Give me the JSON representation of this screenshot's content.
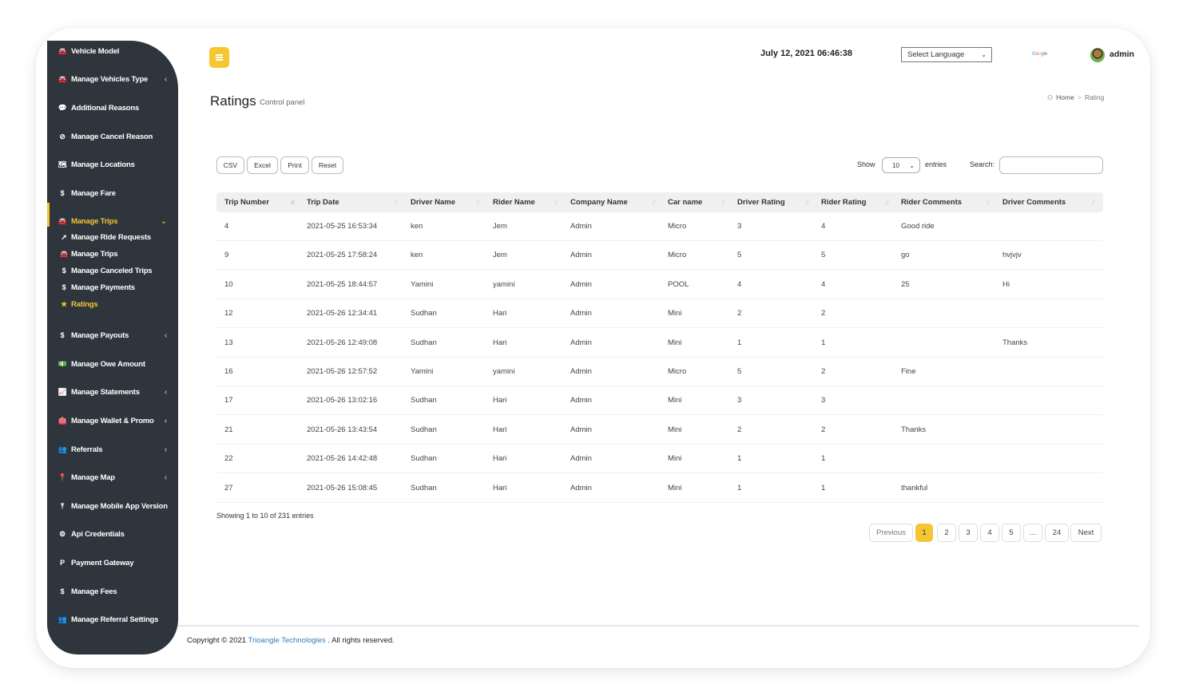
{
  "sidebar": {
    "items": [
      {
        "icon": "car-icon",
        "glyph": "🚘",
        "label": "Vehicle Model",
        "chevron": false
      },
      {
        "icon": "car-icon",
        "glyph": "🚘",
        "label": "Manage Vehicles Type",
        "chevron": true
      },
      {
        "icon": "comment-icon",
        "glyph": "💬",
        "label": "Additional Reasons",
        "chevron": false
      },
      {
        "icon": "ban-icon",
        "glyph": "⊘",
        "label": "Manage Cancel Reason",
        "chevron": false
      },
      {
        "icon": "map-icon",
        "glyph": "🗺",
        "label": "Manage Locations",
        "chevron": false
      },
      {
        "icon": "dollar-icon",
        "glyph": "$",
        "label": "Manage Fare",
        "chevron": false
      },
      {
        "icon": "car-icon",
        "glyph": "🚘",
        "label": "Manage Trips",
        "chevron": true,
        "active": true,
        "expanded": true
      },
      {
        "icon": "dollar-icon",
        "glyph": "$",
        "label": "Manage Payouts",
        "chevron": true
      },
      {
        "icon": "money-icon",
        "glyph": "💵",
        "label": "Manage Owe Amount",
        "chevron": false
      },
      {
        "icon": "chart-area-icon",
        "glyph": "📈",
        "label": "Manage Statements",
        "chevron": true
      },
      {
        "icon": "wallet-icon",
        "glyph": "👛",
        "label": "Manage Wallet & Promo",
        "chevron": true
      },
      {
        "icon": "users-icon",
        "glyph": "👥",
        "label": "Referrals",
        "chevron": true
      },
      {
        "icon": "map-marker-icon",
        "glyph": "📍",
        "label": "Manage Map",
        "chevron": true
      },
      {
        "icon": "upload-icon",
        "glyph": "⤒",
        "label": "Manage Mobile App Version",
        "chevron": false
      },
      {
        "icon": "gear-icon",
        "glyph": "⚙",
        "label": "Api Credentials",
        "chevron": false
      },
      {
        "icon": "paypal-icon",
        "glyph": "P",
        "label": "Payment Gateway",
        "chevron": false
      },
      {
        "icon": "dollar-icon",
        "glyph": "$",
        "label": "Manage Fees",
        "chevron": false
      },
      {
        "icon": "users-icon",
        "glyph": "👥",
        "label": "Manage Referral Settings",
        "chevron": false
      }
    ],
    "subitems": [
      {
        "icon": "paper-plane-icon",
        "glyph": "➚",
        "label": "Manage Ride Requests"
      },
      {
        "icon": "car-icon",
        "glyph": "🚘",
        "label": "Manage Trips"
      },
      {
        "icon": "canceled-money-icon",
        "glyph": "$",
        "label": "Manage Canceled Trips"
      },
      {
        "icon": "dollar-icon",
        "glyph": "$",
        "label": "Manage Payments"
      },
      {
        "icon": "star-icon",
        "glyph": "★",
        "label": "Ratings",
        "active": true
      }
    ],
    "chevron_left": "‹",
    "chevron_down": "⌄"
  },
  "header": {
    "datetime": "July 12, 2021 06:46:38",
    "language_select": "Select Language",
    "google_label": [
      "G",
      "o",
      "o",
      "g",
      "l",
      "e"
    ],
    "user_name": "admin"
  },
  "page": {
    "title": "Ratings",
    "subtitle": "Control panel",
    "breadcrumb": {
      "home": "Home",
      "separator": ">",
      "current": "Rating"
    }
  },
  "toolbar": {
    "buttons": [
      "CSV",
      "Excel",
      "Print",
      "Reset"
    ],
    "show_label": "Show",
    "page_size": "10",
    "entries_label": "entries",
    "search_label": "Search:",
    "search_value": ""
  },
  "table": {
    "columns": [
      "Trip Number",
      "Trip Date",
      "Driver Name",
      "Rider Name",
      "Company Name",
      "Car name",
      "Driver Rating",
      "Rider Rating",
      "Rider Comments",
      "Driver Comments"
    ],
    "rows": [
      [
        "4",
        "2021-05-25 16:53:34",
        "ken",
        "Jem",
        "Admin",
        "Micro",
        "3",
        "4",
        "Good ride",
        ""
      ],
      [
        "9",
        "2021-05-25 17:58:24",
        "ken",
        "Jem",
        "Admin",
        "Micro",
        "5",
        "5",
        "go",
        "hvjvjv"
      ],
      [
        "10",
        "2021-05-25 18:44:57",
        "Yamini",
        "yamini",
        "Admin",
        "POOL",
        "4",
        "4",
        "25",
        "Hi"
      ],
      [
        "12",
        "2021-05-26 12:34:41",
        "Sudhan",
        "Hari",
        "Admin",
        "Mini",
        "2",
        "2",
        "",
        ""
      ],
      [
        "13",
        "2021-05-26 12:49:08",
        "Sudhan",
        "Hari",
        "Admin",
        "Mini",
        "1",
        "1",
        "",
        "Thanks"
      ],
      [
        "16",
        "2021-05-26 12:57:52",
        "Yamini",
        "yamini",
        "Admin",
        "Micro",
        "5",
        "2",
        "Fine",
        ""
      ],
      [
        "17",
        "2021-05-26 13:02:16",
        "Sudhan",
        "Hari",
        "Admin",
        "Mini",
        "3",
        "3",
        "",
        ""
      ],
      [
        "21",
        "2021-05-26 13:43:54",
        "Sudhan",
        "Hari",
        "Admin",
        "Mini",
        "2",
        "2",
        "Thanks",
        ""
      ],
      [
        "22",
        "2021-05-26 14:42:48",
        "Sudhan",
        "Hari",
        "Admin",
        "Mini",
        "1",
        "1",
        "",
        ""
      ],
      [
        "27",
        "2021-05-26 15:08:45",
        "Sudhan",
        "Hari",
        "Admin",
        "Mini",
        "1",
        "1",
        "thankful",
        ""
      ]
    ],
    "info": "Showing 1 to 10 of 231 entries"
  },
  "pagination": {
    "previous": "Previous",
    "pages": [
      "1",
      "2",
      "3",
      "4",
      "5",
      "…",
      "24"
    ],
    "current": "1",
    "next": "Next"
  },
  "footer": {
    "prefix": "Copyright © 2021",
    "company": "Trioangle Technologies",
    "suffix": ". All rights reserved."
  },
  "colors": {
    "accent": "#f5c631",
    "sidebar_bg": "#2f353d",
    "link": "#2f7ec1"
  }
}
